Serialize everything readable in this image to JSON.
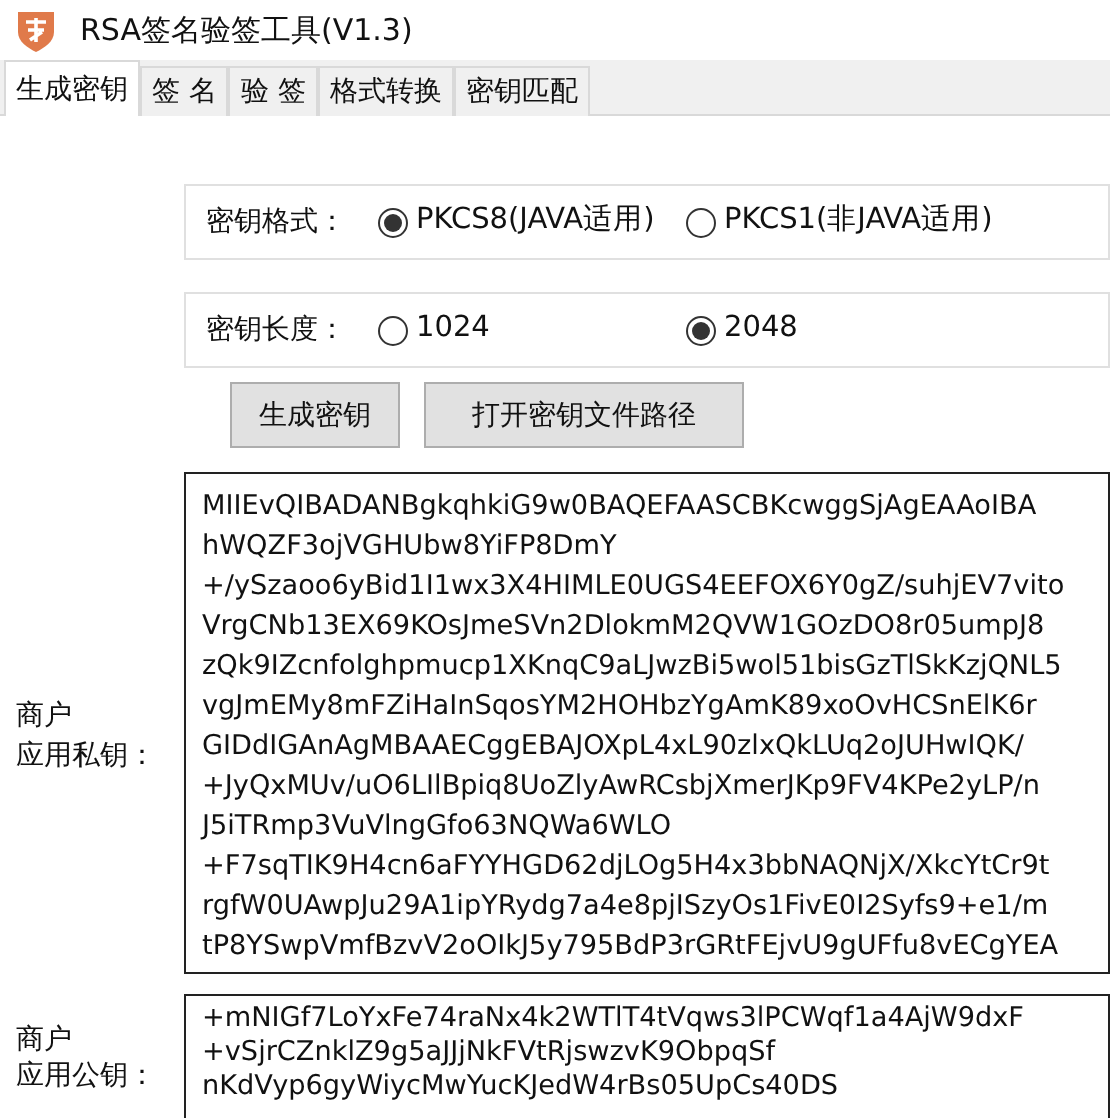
{
  "window": {
    "title": "RSA签名验签工具(V1.3)"
  },
  "tabs": [
    {
      "label": "生成密钥",
      "selected": true
    },
    {
      "label": "签 名",
      "selected": false
    },
    {
      "label": "验 签",
      "selected": false
    },
    {
      "label": "格式转换",
      "selected": false
    },
    {
      "label": "密钥匹配",
      "selected": false
    }
  ],
  "key_format": {
    "label": "密钥格式：",
    "options": [
      {
        "label": "PKCS8(JAVA适用)",
        "selected": true
      },
      {
        "label": "PKCS1(非JAVA适用)",
        "selected": false
      }
    ]
  },
  "key_length": {
    "label": "密钥长度：",
    "options": [
      {
        "label": "1024",
        "selected": false
      },
      {
        "label": "2048",
        "selected": true
      }
    ]
  },
  "buttons": [
    "生成密钥",
    "打开密钥文件路径"
  ],
  "private_key": {
    "label_lines": [
      "商户",
      "应用私钥："
    ],
    "lines": [
      "MIIEvQIBADANBgkqhkiG9w0BAQEFAASCBKcwggSjAgEAAoIBA",
      "hWQZF3ojVGHUbw8YiFP8DmY",
      "+/ySzaoo6yBid1I1wx3X4HIMLE0UGS4EEFOX6Y0gZ/suhjEV7vito",
      "VrgCNb13EX69KOsJmeSVn2DlokmM2QVW1GOzDO8r05umpJ8",
      "zQk9IZcnfolghpmucp1XKnqC9aLJwzBi5wol51bisGzTlSkKzjQNL5",
      "vgJmEMy8mFZiHaInSqosYM2HOHbzYgAmK89xoOvHCSnElK6r",
      "GIDdIGAnAgMBAAECggEBAJOXpL4xL90zlxQkLUq2oJUHwIQK/",
      "+JyQxMUv/uO6LIlBpiq8UoZlyAwRCsbjXmerJKp9FV4KPe2yLP/n",
      "J5iTRmp3VuVlngGfo63NQWa6WLO",
      "+F7sqTIK9H4cn6aFYYHGD62djLOg5H4x3bbNAQNjX/XkcYtCr9t",
      "rgfW0UAwpJu29A1ipYRydg7a4e8pjISzyOs1FivE0I2Syfs9+e1/m",
      "tP8YSwpVmfBzvV2oOIkJ5y795BdP3rGRtFEjvU9gUFfu8vECgYEA"
    ]
  },
  "public_key": {
    "label_lines": [
      "商户",
      "应用公钥："
    ],
    "lines": [
      "+mNIGf7LoYxFe74raNx4k2WTlT4tVqws3lPCWqf1a4AjW9dxF",
      "+vSjrCZnklZ9g5aJJjNkFVtRjswzvK9ObpqSf",
      "nKdVyp6gyWiycMwYucKJedW4rBs05UpCs40DS"
    ]
  }
}
